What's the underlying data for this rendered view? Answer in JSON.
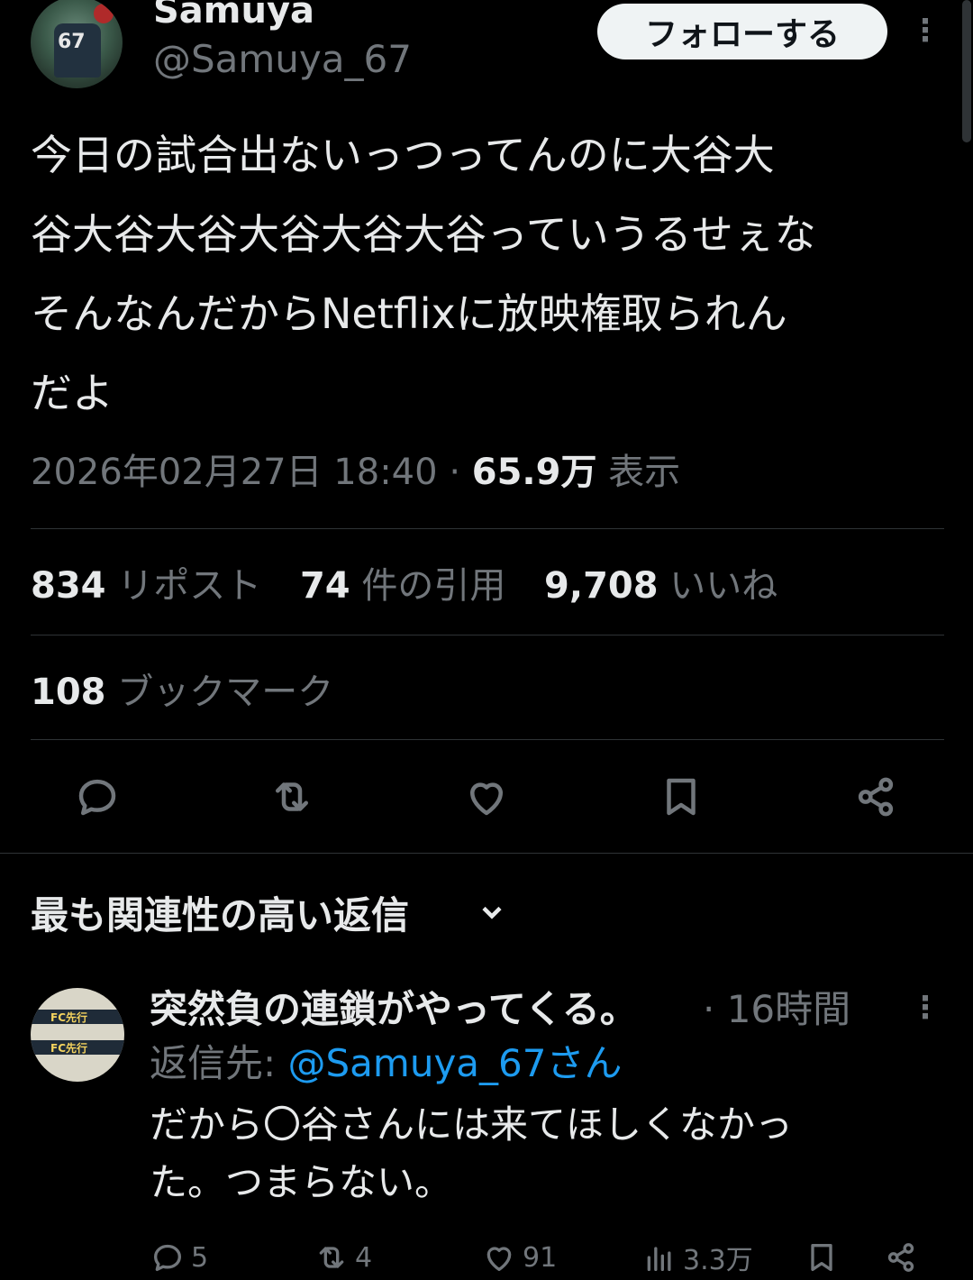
{
  "author": {
    "name": "Samuya",
    "handle": "@Samuya_67",
    "follow_label": "フォローする",
    "avatar_jersey_number": "67"
  },
  "tweet": {
    "lines": [
      "今日の試合出ないっつってんのに大谷大",
      "谷大谷大谷大谷大谷大谷っていうるせぇな",
      "そんなんだからNetflixに放映権取られん",
      "だよ"
    ],
    "datetime": "2026年02月27日 18:40",
    "separator": "·",
    "views_count": "65.9万",
    "views_label": "表示"
  },
  "stats": {
    "reposts_count": "834",
    "reposts_label": "リポスト",
    "quotes_count": "74",
    "quotes_label": "件の引用",
    "likes_count": "9,708",
    "likes_label": "いいね",
    "bookmarks_count": "108",
    "bookmarks_label": "ブックマーク"
  },
  "actions": [
    "reply-icon",
    "repost-icon",
    "like-icon",
    "bookmark-icon",
    "share-icon"
  ],
  "replies_section": {
    "title": "最も関連性の高い返信"
  },
  "reply": {
    "name": "突然負の連鎖がやってくる。",
    "time": "· 16時間",
    "reply_to_label": "返信先: ",
    "reply_to_mention": "@Samuya_67さん",
    "lines": [
      "だから〇谷さんには来てほしくなかっ",
      "た。つまらない。"
    ],
    "avatar_label_1": "FC先行",
    "avatar_label_2": "FC先行",
    "reply_count": "5",
    "repost_count": "4",
    "like_count": "91",
    "views_count": "3.3万"
  },
  "colors": {
    "background": "#000000",
    "text": "#e7e9ea",
    "muted": "#71767b",
    "divider": "#2f3336",
    "link": "#1d9bf0",
    "follow_button_bg": "#eff3f4"
  }
}
